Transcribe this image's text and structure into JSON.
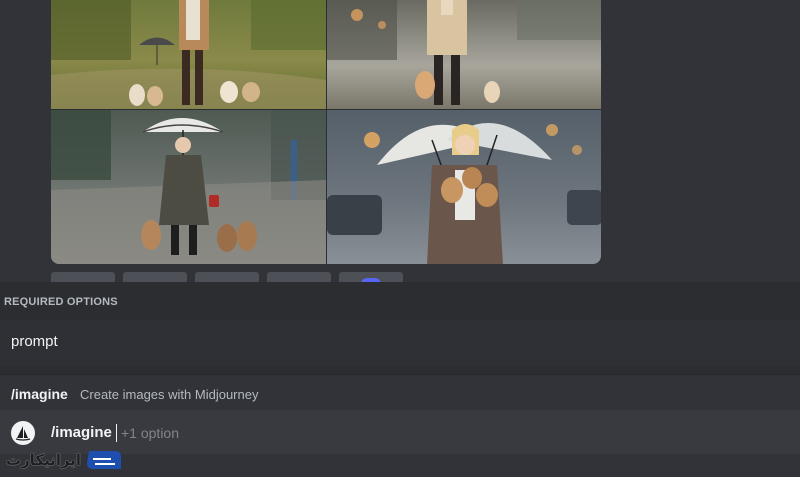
{
  "gallery": {
    "tiles": [
      {
        "name": "woman-with-puppies-park"
      },
      {
        "name": "woman-with-puppies-street"
      },
      {
        "name": "woman-umbrella-puppies-rain"
      },
      {
        "name": "woman-holding-puppies-rain"
      }
    ]
  },
  "popup": {
    "header": "REQUIRED OPTIONS",
    "option_label": "prompt",
    "command_name": "/imagine",
    "command_description": "Create images with Midjourney"
  },
  "input": {
    "command": "/imagine",
    "hint": "+1 option"
  },
  "watermark": {
    "text": "ایرانیکارت"
  },
  "colors": {
    "background": "#313338",
    "popup": "#2b2d31",
    "input": "#383a40",
    "accent": "#5865f2"
  }
}
